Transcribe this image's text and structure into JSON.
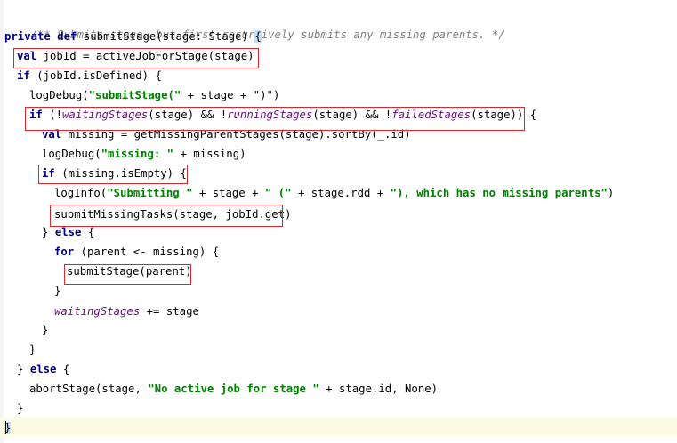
{
  "editor": {
    "language": "scala",
    "accent_highlight_color": "#d9272e",
    "current_line_color": "#fcfbe4",
    "code": {
      "line1": "/** Submits stage, but first recursively submits any missing parents. */",
      "line2": {
        "kw1": "private",
        "kw2": "def",
        "text": "submitStage(stage: Stage)",
        "brace": "{"
      },
      "line3": {
        "kw": "val",
        "text": "jobId = activeJobForStage(stage)"
      },
      "line4": {
        "kw": "if",
        "text": "(jobId.isDefined) {"
      },
      "line5": {
        "pre": "logDebug(",
        "str": "\"submitStage(\"",
        "post": " + stage + \")\")"
      },
      "line6": {
        "kw": "if",
        "p1": "(!",
        "f1": "waitingStages",
        "p2": "(stage) && !",
        "f2": "runningStages",
        "p3": "(stage) && !",
        "f3": "failedStages",
        "p4": "(stage)) {"
      },
      "line7": {
        "kw": "val",
        "text": "missing = getMissingParentStages(stage).sortBy(_.id)"
      },
      "line8": {
        "pre": "logDebug(",
        "str": "\"missing: \"",
        "post": " + missing)"
      },
      "line9": {
        "kw": "if",
        "text": "(missing.isEmpty) {"
      },
      "line10": {
        "pre": "logInfo(",
        "s1": "\"Submitting \"",
        "m1": " + stage + ",
        "s2": "\" (\"",
        "m2": " + stage.rdd + ",
        "s3": "\"), which has no missing parents\"",
        "post": ")"
      },
      "line11": "submitMissingTasks(stage, jobId.get)",
      "line12": {
        "pre": "} ",
        "kw": "else",
        "post": " {"
      },
      "line13": {
        "kw": "for",
        "text": "(parent <- missing) {"
      },
      "line14": "submitStage(parent)",
      "line15": "}",
      "line16": {
        "fld": "waitingStages",
        "post": " += stage"
      },
      "line17": "}",
      "line18": "}",
      "line19": {
        "pre": "} ",
        "kw": "else",
        "post": " {"
      },
      "line20": {
        "pre": "abortStage(stage, ",
        "str": "\"No active job for stage \"",
        "post": " + stage.id, None)"
      },
      "line21": "}",
      "line22": "}"
    }
  }
}
